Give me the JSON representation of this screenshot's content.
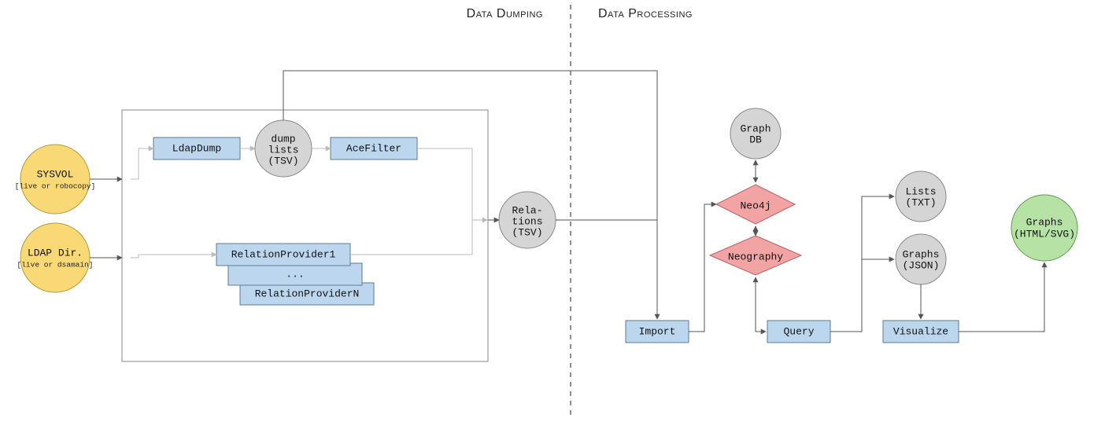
{
  "sections": {
    "left": "Data Dumping",
    "right": "Data Processing"
  },
  "sources": {
    "sysvol": {
      "title": "SYSVOL",
      "sub": "[live or robocopy]"
    },
    "ldap": {
      "title": "LDAP Dir.",
      "sub": "[live or dsamain]"
    }
  },
  "dump": {
    "ldapdump": "LdapDump",
    "dumplists": {
      "l1": "dump",
      "l2": "lists",
      "l3": "(TSV)"
    },
    "acefilter": "AceFilter",
    "rp1": "RelationProvider1",
    "rp_mid": "...",
    "rpN": "RelationProviderN",
    "relations": {
      "l1": "Rela-",
      "l2": "tions",
      "l3": "(TSV)"
    }
  },
  "proc": {
    "import": "Import",
    "query": "Query",
    "visualize": "Visualize",
    "graphdb": {
      "l1": "Graph",
      "l2": "DB"
    },
    "neo4j": "Neo4j",
    "neography": "Neography",
    "lists": {
      "l1": "Lists",
      "l2": "(TXT)"
    },
    "graphs_json": {
      "l1": "Graphs",
      "l2": "(JSON)"
    },
    "graphs_html": {
      "l1": "Graphs",
      "l2": "(HTML/SVG)"
    }
  },
  "colors": {
    "blue": "#bcd6ed",
    "yellow": "#f9d976",
    "gray": "#d5d5d5",
    "red": "#f2a3a3",
    "green": "#b6e3a5"
  }
}
